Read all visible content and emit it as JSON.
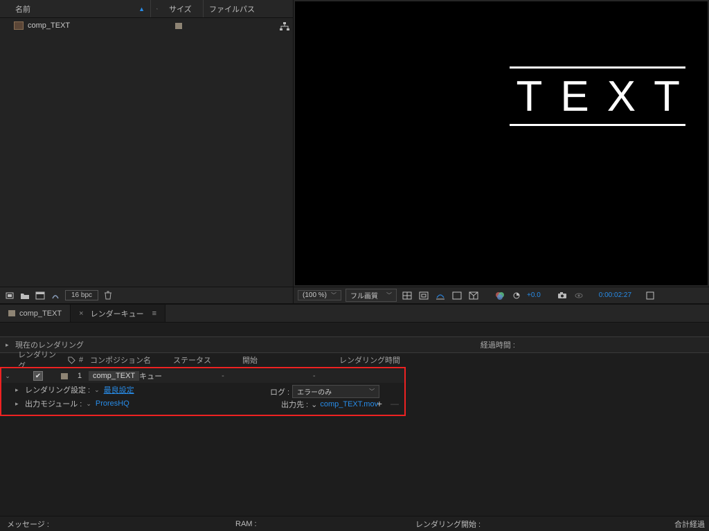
{
  "project": {
    "columns": {
      "name": "名前",
      "size": "サイズ",
      "path": "ファイルパス"
    },
    "items": [
      {
        "name": "comp_TEXT"
      }
    ],
    "bpc": "16 bpc"
  },
  "preview": {
    "text": "TEXT",
    "zoom": "(100 %)",
    "quality": "フル画質",
    "exposure": "+0.0",
    "timecode": "0:00:02:27"
  },
  "tabs": [
    {
      "label": "comp_TEXT"
    },
    {
      "label": "レンダーキュー"
    }
  ],
  "renderQueue": {
    "currentLabel": "現在のレンダリング",
    "elapsedLabel": "経過時間 :",
    "cols": {
      "render": "レンダリング",
      "num": "#",
      "comp": "コンポジション名",
      "status": "ステータス",
      "start": "開始",
      "time": "レンダリング時間"
    },
    "item": {
      "num": "1",
      "comp": "comp_TEXT",
      "status": "キュー",
      "dash": "-",
      "settingsLabel": "レンダリング設定 :",
      "settingsValue": "最良設定",
      "moduleLabel": "出力モジュール :",
      "moduleValue": "ProresHQ",
      "logLabel": "ログ :",
      "logValue": "エラーのみ",
      "outLabel": "出力先 :",
      "outValue": "comp_TEXT.mov"
    }
  },
  "status": {
    "message": "メッセージ :",
    "ram": "RAM :",
    "renderStart": "レンダリング開始 :",
    "totalElapsed": "合計経過"
  }
}
